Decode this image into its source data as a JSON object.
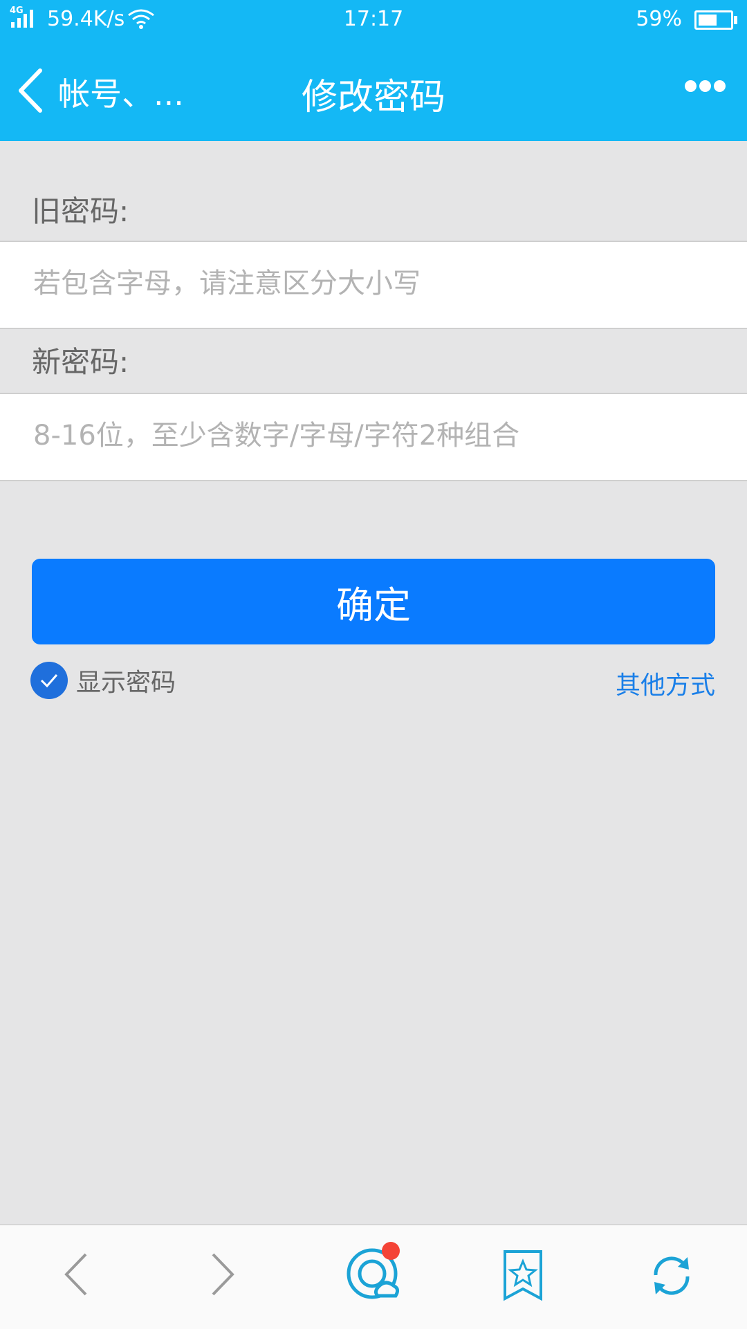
{
  "status_bar": {
    "network": "4G",
    "speed": "59.4K/s",
    "time": "17:17",
    "battery": "59%"
  },
  "header": {
    "back_label": "帐号、...",
    "title": "修改密码"
  },
  "form": {
    "old_password_label": "旧密码:",
    "old_password_placeholder": "若包含字母，请注意区分大小写",
    "new_password_label": "新密码:",
    "new_password_placeholder": "8-16位，至少含数字/字母/字符2种组合"
  },
  "actions": {
    "confirm_label": "确定",
    "show_password_label": "显示密码",
    "other_methods_label": "其他方式"
  },
  "colors": {
    "header_bg": "#14b8f5",
    "button_bg": "#0a7bff",
    "link": "#1a7fe8",
    "badge": "#f44336"
  },
  "toolbar": {
    "icons": [
      "back-icon",
      "forward-icon",
      "chat-icon",
      "bookmark-icon",
      "refresh-icon"
    ]
  }
}
